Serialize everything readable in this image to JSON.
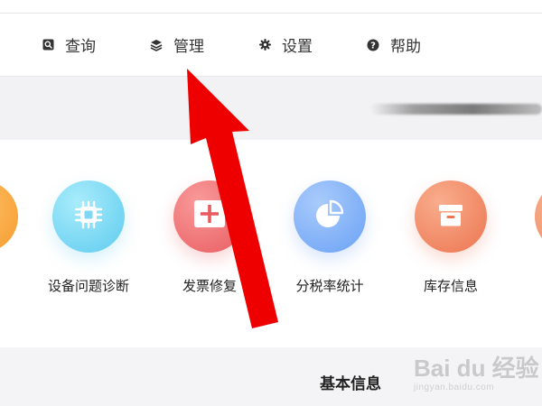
{
  "nav": {
    "items": [
      {
        "label": "查询",
        "icon": "search-icon"
      },
      {
        "label": "管理",
        "icon": "layers-icon"
      },
      {
        "label": "设置",
        "icon": "gear-icon"
      },
      {
        "label": "帮助",
        "icon": "help-icon"
      }
    ]
  },
  "apps": [
    {
      "label": "设备问题诊断",
      "icon": "chip-icon",
      "color": "#6dd3f0"
    },
    {
      "label": "发票修复",
      "icon": "plus-box-icon",
      "color": "#ef6b6e"
    },
    {
      "label": "分税率统计",
      "icon": "pie-chart-icon",
      "color": "#6ea6f7"
    },
    {
      "label": "库存信息",
      "icon": "archive-box-icon",
      "color": "#f0855e"
    }
  ],
  "section": {
    "title": "基本信息"
  },
  "watermark": {
    "logo": "Bai du 经验",
    "url": "jingyan.baidu.com"
  },
  "annotation": {
    "arrow_color": "#ee0000"
  }
}
